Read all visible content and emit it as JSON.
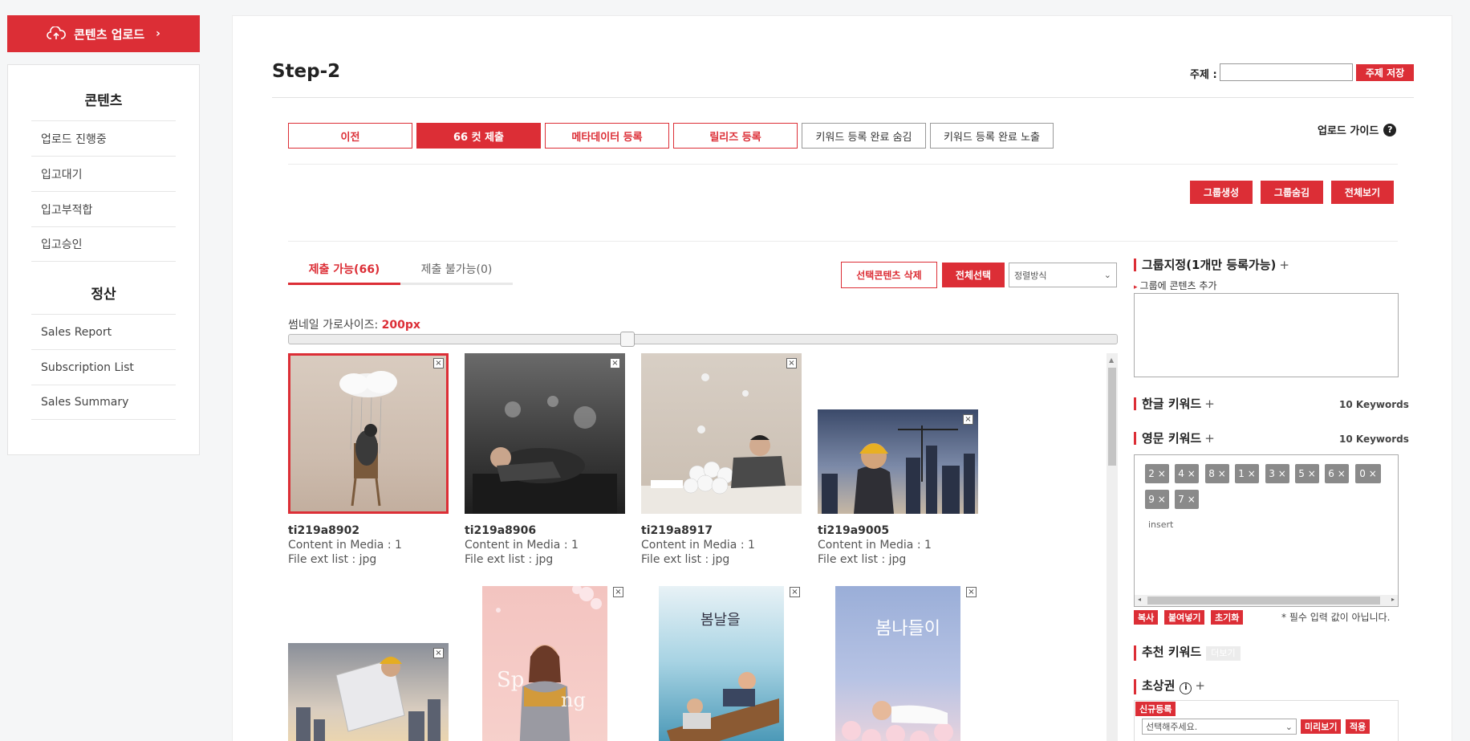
{
  "sidebar": {
    "upload_label": "콘텐츠 업로드",
    "content_title": "콘텐츠",
    "content_items": [
      {
        "label": "업로드 진행중"
      },
      {
        "label": "입고대기"
      },
      {
        "label": "입고부적합"
      },
      {
        "label": "입고승인"
      }
    ],
    "settle_title": "정산",
    "settle_items": [
      {
        "label": "Sales Report"
      },
      {
        "label": "Subscription List"
      },
      {
        "label": "Sales Summary"
      }
    ]
  },
  "header": {
    "title": "Step-2",
    "subject_label": "주제 :",
    "subject_value": "",
    "subject_save": "주제 저장",
    "guide_label": "업로드 가이드"
  },
  "steps": [
    {
      "label": "이전"
    },
    {
      "label": "66 컷 제출"
    },
    {
      "label": "메타데이터 등록"
    },
    {
      "label": "릴리즈 등록"
    },
    {
      "label": "키워드 등록 완료 숨김"
    },
    {
      "label": "키워드 등록 완료 노출"
    }
  ],
  "group_buttons": [
    {
      "label": "그룹생성"
    },
    {
      "label": "그룹숨김"
    },
    {
      "label": "전체보기"
    }
  ],
  "tabs": [
    {
      "label": "제출 가능(66)"
    },
    {
      "label": "제출 불가능(0)"
    }
  ],
  "toolbar": {
    "delete_label": "선택콘텐츠 삭제",
    "select_all_label": "전체선택",
    "sort_value": "정렬방식"
  },
  "thumb_size": {
    "label": "썸네일 가로사이즈:",
    "value": "200px"
  },
  "items": [
    {
      "name": "ti219a8902",
      "media": "Content in Media : 1",
      "ext": "File ext list : jpg"
    },
    {
      "name": "ti219a8906",
      "media": "Content in Media : 1",
      "ext": "File ext list : jpg"
    },
    {
      "name": "ti219a8917",
      "media": "Content in Media : 1",
      "ext": "File ext list : jpg"
    },
    {
      "name": "ti219a9005",
      "media": "Content in Media : 1",
      "ext": "File ext list : jpg"
    }
  ],
  "right_panel": {
    "group_title": "그룹지정(1개만 등록가능)",
    "group_sub": "그룹에 콘텐츠 추가",
    "kr_title": "한글 키워드",
    "kr_count": "10 Keywords",
    "en_title": "영문 키워드",
    "en_count": "10 Keywords",
    "keywords": [
      "2",
      "4",
      "8",
      "1",
      "3",
      "5",
      "6",
      "0",
      "9",
      "7"
    ],
    "insert_text": "insert",
    "copy_label": "복사",
    "paste_label": "붙여넣기",
    "reset_label": "초기화",
    "required_note": "* 필수 입력 값이 아닙니다.",
    "recommend_title": "추천 키워드",
    "recommend_more": "더보기",
    "portrait_title": "초상권",
    "new_reg_label": "신규등록",
    "portrait_select": "선택해주세요.",
    "preview_label": "미리보기",
    "apply_label": "적용"
  }
}
